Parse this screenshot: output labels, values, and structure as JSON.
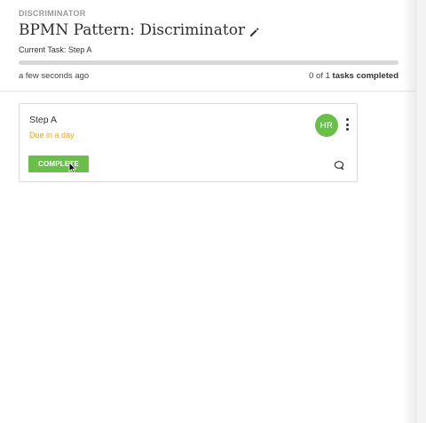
{
  "header": {
    "kicker": "DISCRIMINATOR",
    "title": "BPMN Pattern: Discriminator",
    "current_task": "Current Task: Step A",
    "progress_fraction": 0,
    "timestamp": "a few seconds ago",
    "tasks_completed_count": "0 of 1",
    "tasks_completed_suffix": "tasks completed"
  },
  "task_card": {
    "name": "Step A",
    "due": "Due in a day",
    "assignee_initials": "HR",
    "complete_label": "COMPLETE"
  },
  "colors": {
    "accent_green": "#6abf4b",
    "due_orange": "#e2a62b",
    "progress_track": "#d8d8d8"
  },
  "icons": {
    "edit": "pencil-icon",
    "menu": "kebab-menu-icon",
    "comment": "comment-icon",
    "cursor": "mouse-pointer-icon"
  }
}
